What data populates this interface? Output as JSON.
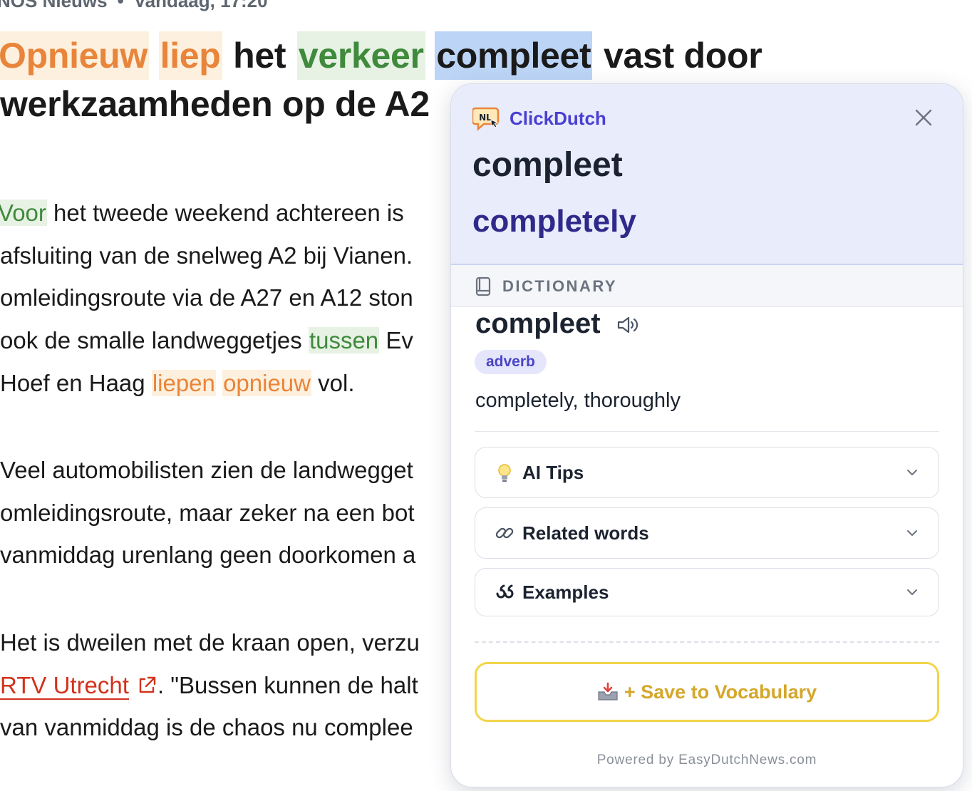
{
  "article": {
    "source": "NOS Nieuws",
    "separator": "•",
    "time": "Vandaag, 17:20",
    "headline": {
      "w1": "Opnieuw",
      "w2": "liep",
      "w3": "het",
      "w4": "verkeer",
      "w5": "compleet",
      "w6": "vast door",
      "line2": "werkzaamheden op de A2"
    },
    "p1": {
      "l1_w": "Voor",
      "l1_rest": " het tweede weekend achtereen is",
      "l2": "afsluiting van de snelweg A2 bij Vianen.",
      "l3": "omleidingsroute via de A27 en A12 ston",
      "l4_a": "ook de smalle landweggetjes ",
      "l4_w": "tussen",
      "l4_b": " Ev",
      "l5_a": "Hoef en Haag ",
      "l5_w1": "liepen",
      "l5_w2": "opnieuw",
      "l5_b": " vol."
    },
    "p2": {
      "l1": "Veel automobilisten zien de landwegget",
      "l2": "omleidingsroute, maar zeker na een bot",
      "l3": "vanmiddag urenlang geen doorkomen a"
    },
    "p3": {
      "l1": "Het is dweilen met de kraan open, verzu",
      "l2_link": "RTV Utrecht",
      "l2_rest": ". \"Bussen kunnen de halt",
      "l3": "van vanmiddag is de chaos nu compleе"
    }
  },
  "popup": {
    "brand": "ClickDutch",
    "logo_text": "NL",
    "word": "compleet",
    "translation": "completely",
    "dictionary_label": "DICTIONARY",
    "entry_word": "compleet",
    "part_of_speech": "adverb",
    "definition": "completely, thoroughly",
    "sections": [
      {
        "label": "AI Tips",
        "icon": "lightbulb-icon"
      },
      {
        "label": "Related words",
        "icon": "link-icon"
      },
      {
        "label": "Examples",
        "icon": "quote-icon"
      }
    ],
    "save_label": "+ Save to Vocabulary",
    "footer": "Powered by EasyDutchNews.com"
  },
  "colors": {
    "orange_highlight": "#e8853a",
    "green_highlight": "#3f8a3c",
    "selection_blue": "#bcd5f6",
    "brand_purple": "#4a3fd1",
    "save_yellow": "#f2d54a",
    "link_red": "#d2321c"
  }
}
